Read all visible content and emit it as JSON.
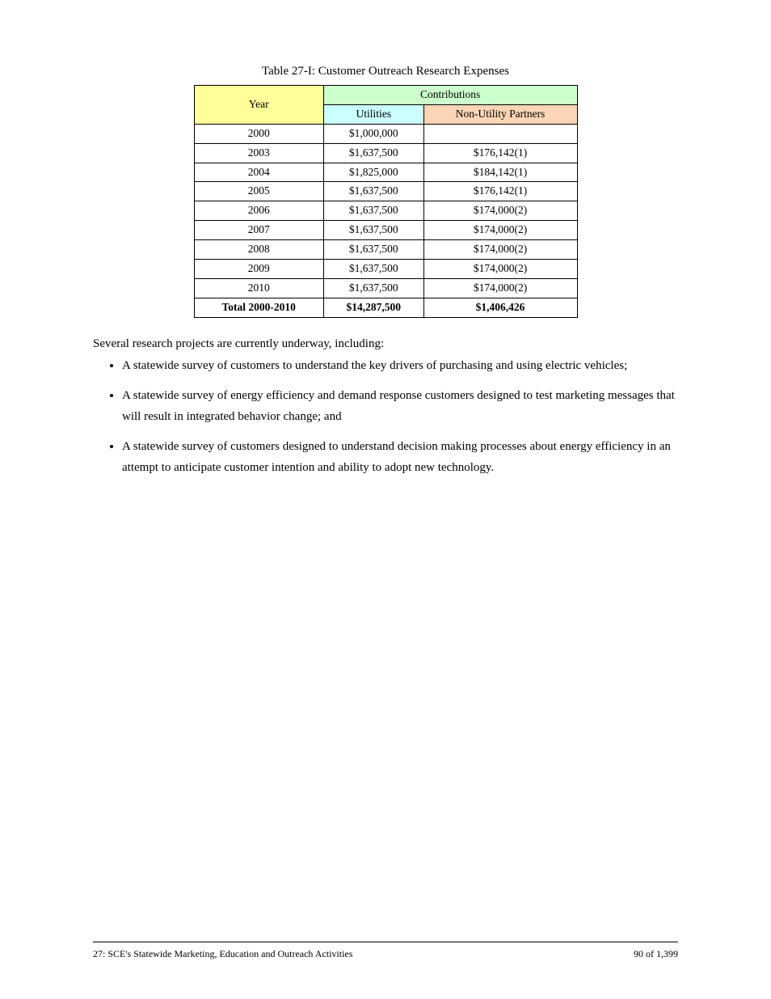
{
  "table": {
    "caption": "Table 27-I: Customer Outreach Research Expenses",
    "headers": {
      "year": "Year",
      "contributions": "Contributions",
      "utilities": "Utilities",
      "partners": "Non-Utility Partners"
    },
    "rows": [
      {
        "year": "2000",
        "utilities": "$1,000,000",
        "partners": ""
      },
      {
        "year": "2003",
        "utilities": "$1,637,500",
        "partners": "$176,142(1)"
      },
      {
        "year": "2004",
        "utilities": "$1,825,000",
        "partners": "$184,142(1)"
      },
      {
        "year": "2005",
        "utilities": "$1,637,500",
        "partners": "$176,142(1)"
      },
      {
        "year": "2006",
        "utilities": "$1,637,500",
        "partners": "$174,000(2)"
      },
      {
        "year": "2007",
        "utilities": "$1,637,500",
        "partners": "$174,000(2)"
      },
      {
        "year": "2008",
        "utilities": "$1,637,500",
        "partners": "$174,000(2)"
      },
      {
        "year": "2009",
        "utilities": "$1,637,500",
        "partners": "$174,000(2)"
      },
      {
        "year": "2010",
        "utilities": "$1,637,500",
        "partners": "$174,000(2)"
      },
      {
        "year": "Total 2000-2010",
        "utilities": "$14,287,500",
        "partners": "$1,406,426"
      }
    ]
  },
  "outline": {
    "label": "Several research projects are currently underway, including:",
    "bullets": [
      "A statewide survey of customers to understand the key drivers of purchasing and using electric vehicles;",
      "A statewide survey of energy efficiency and demand response customers designed to test marketing messages that will result in integrated behavior change; and",
      "A statewide survey of customers designed to understand decision making processes about energy efficiency in an attempt to anticipate customer intention and ability to adopt new technology."
    ]
  },
  "footer": {
    "left": "27: SCE's Statewide Marketing, Education and Outreach Activities",
    "right": "90 of 1,399"
  }
}
